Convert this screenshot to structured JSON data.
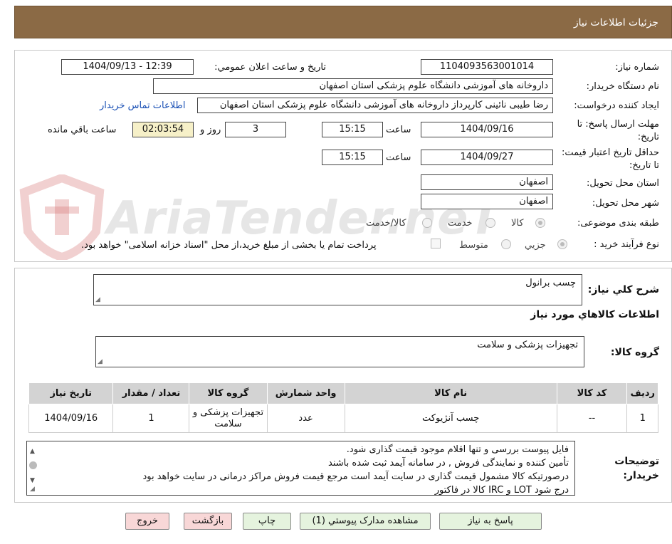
{
  "header": {
    "title": "جزئیات اطلاعات نیاز"
  },
  "form": {
    "need_number": {
      "label": "شماره نیاز:",
      "value": "1104093563001014"
    },
    "announce": {
      "label": "تاریخ و ساعت اعلان عمومي:",
      "value": "1404/09/13 - 12:39"
    },
    "buyer_org": {
      "label": "نام دستگاه خریدار:",
      "value": "داروخانه های آموزشی دانشگاه علوم پزشکی استان اصفهان"
    },
    "requester": {
      "label": "ایجاد کننده درخواست:",
      "value": "رضا طیبی نائینی کارپرداز داروخانه های آموزشی دانشگاه علوم پزشکی استان اصفهان",
      "contact_link": "اطلاعات تماس خریدار"
    },
    "deadline": {
      "label": "مهلت ارسال پاسخ: تا تاریخ:",
      "date": "1404/09/16",
      "time_label": "ساعت",
      "time": "15:15",
      "days": "3",
      "days_label": "روز و",
      "remaining": "02:03:54",
      "remaining_label": "ساعت باقي مانده"
    },
    "validity": {
      "label": "حداقل تاريخ اعتبار قيمت: تا تاريخ:",
      "date": "1404/09/27",
      "time_label": "ساعت",
      "time": "15:15"
    },
    "province": {
      "label": "استان محل تحویل:",
      "value": "اصفهان"
    },
    "city": {
      "label": "شهر محل تحویل:",
      "value": "اصفهان"
    },
    "category": {
      "label": "طبقه بندی موضوعی:",
      "options": [
        "کالا",
        "خدمت",
        "کالا/خدمت"
      ],
      "selected": "کالا"
    },
    "purchase_type": {
      "label": "نوع فرآیند خرید :",
      "options": [
        "جزیي",
        "متوسط"
      ],
      "selected": "جزیي",
      "treasury_note": "پرداخت تمام یا بخشی از مبلغ خرید،از محل \"اسناد خزانه اسلامی\" خواهد بود."
    }
  },
  "description": {
    "label": "شرح کلي نياز:",
    "value": "چسب برانول"
  },
  "goods_section": {
    "title": "اطلاعات کالاهاي مورد نياز",
    "group_label": "گروه کالا:",
    "group_value": "تجهیزات پزشکی و سلامت"
  },
  "items_table": {
    "headers": [
      "رديف",
      "کد کالا",
      "نام کالا",
      "واحد شمارش",
      "گروه کالا",
      "تعداد / مقدار",
      "تاريخ نياز"
    ],
    "rows": [
      [
        "1",
        "--",
        "چسب آنژیوکت",
        "عدد",
        "تجهیزات پزشکی و سلامت",
        "1",
        "1404/09/16"
      ]
    ]
  },
  "buyer_notes": {
    "label": "توضيحات خريدار:",
    "lines": [
      "فایل پیوست بررسی و تنها اقلام موجود قیمت گذاری شود.",
      "تأمین کننده و نمایندگی فروش  , در سامانه آیمد ثبت شده باشند",
      "درصورتیکه کالا مشمول قیمت گذاری در سایت آیمد است مرجع قیمت فروش مراکز درمانی در سایت خواهد بود",
      "درج شود LOT و IRC کالا در فاکتور"
    ]
  },
  "buttons": {
    "reply": "پاسخ به نياز",
    "attachments": "مشاهده مدارک پيوستي (1)",
    "print": "چاپ",
    "back": "بازگشت",
    "exit": "خروج"
  },
  "colors": {
    "header_bg": "#8b6a45",
    "table_header_bg": "#d3d3d3",
    "highlight_box": "#f6f0c8",
    "link": "#1a50b5"
  }
}
